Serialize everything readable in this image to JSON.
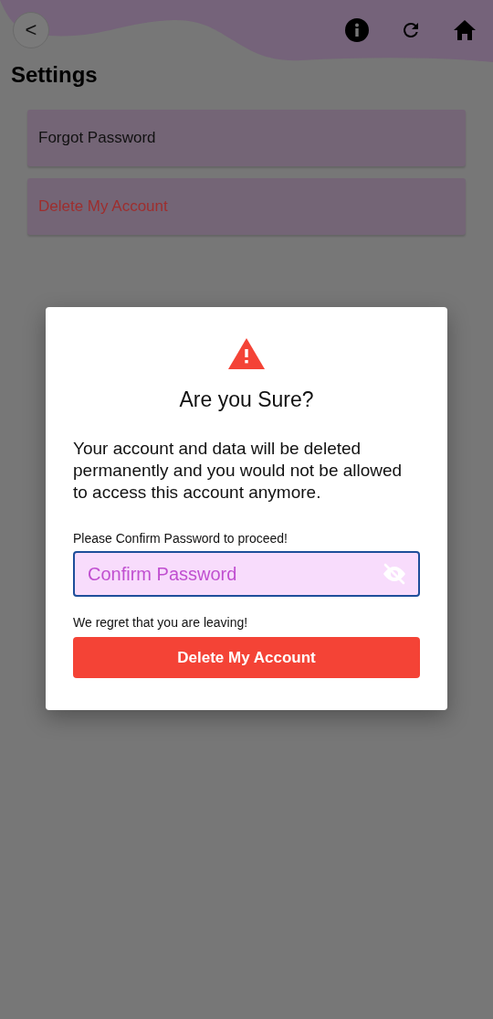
{
  "header": {
    "back_label": "<"
  },
  "title": "Settings",
  "settings_items": [
    {
      "label": "Forgot Password",
      "kind": "normal"
    },
    {
      "label": "Delete My Account",
      "kind": "danger"
    }
  ],
  "dialog": {
    "title": "Are you Sure?",
    "message": "Your account and data will be deleted permanently and you would not be allowed to access this account anymore.",
    "field_label": "Please Confirm Password to proceed!",
    "password_field": {
      "placeholder": "Confirm Password"
    },
    "note": "We regret that you are leaving!",
    "button": "Delete My Account"
  }
}
